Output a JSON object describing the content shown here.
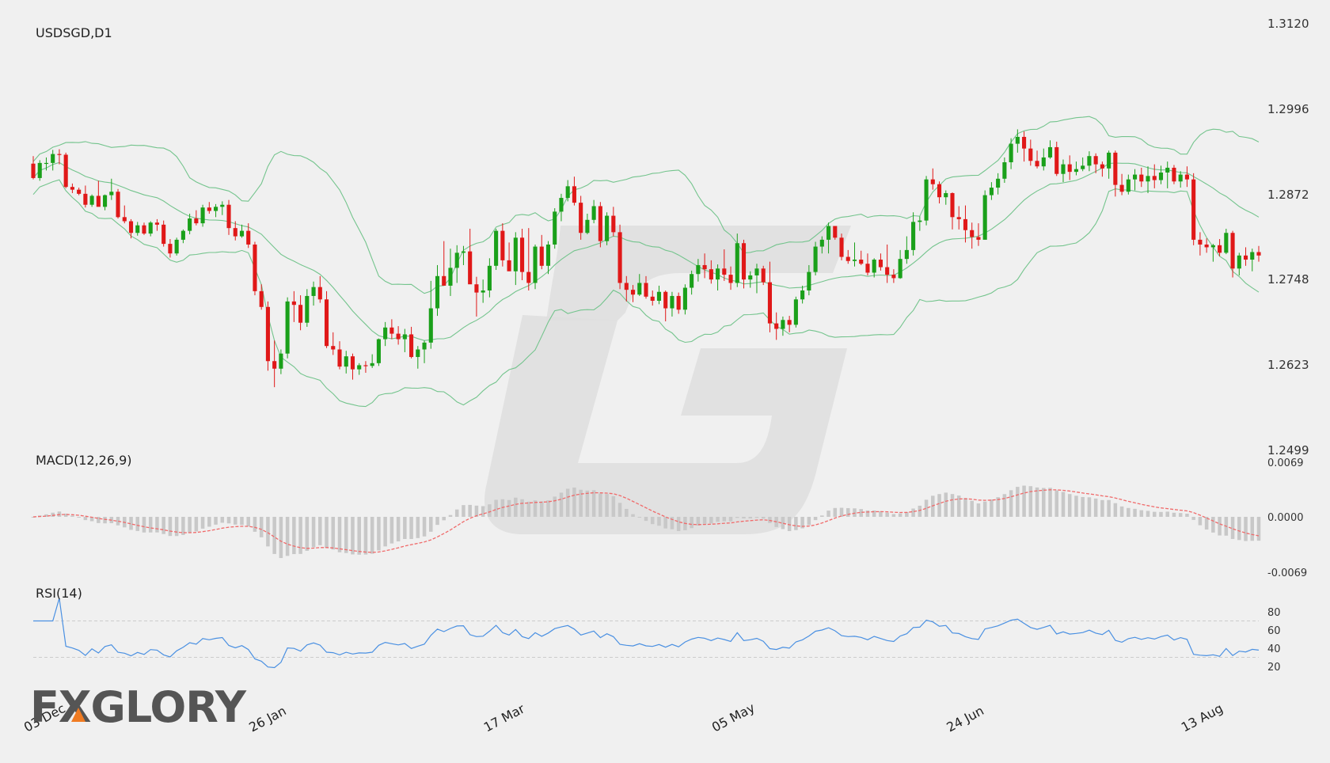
{
  "brand": {
    "logo_text": "FXGLORY",
    "accent": "#f07b22"
  },
  "colors": {
    "background": "#f0f0f0",
    "bull": "#1aa01a",
    "bear": "#e01818",
    "band": "#74c48d",
    "macd_line": "#f06a6a",
    "macd_hist": "#c8c8c8",
    "rsi_line": "#4a90e2",
    "grid_dash": "#cccccc",
    "watermark": "#dedede"
  },
  "chart_data": [
    {
      "type": "candlestick",
      "title": "USDSGD,D1",
      "symbol": "USDSGD",
      "timeframe": "D1",
      "ylim": [
        1.2499,
        1.312
      ],
      "y_ticks": [
        "1.3120",
        "1.2996",
        "1.2872",
        "1.2748",
        "1.2623",
        "1.2499"
      ],
      "x_tick_labels": [
        "03 Dec",
        "26 Jan",
        "17 Mar",
        "05 May",
        "24 Jun",
        "13 Aug"
      ],
      "x_tick_index": [
        0,
        36,
        72,
        107,
        143,
        179
      ],
      "bollinger": {
        "period": 20,
        "deviations": 2
      },
      "ohlc": [
        [
          1.2916,
          1.2927,
          1.2893,
          1.2895
        ],
        [
          1.2895,
          1.2921,
          1.2891,
          1.2917
        ],
        [
          1.2917,
          1.2925,
          1.2906,
          1.2917
        ],
        [
          1.2917,
          1.2936,
          1.2906,
          1.293
        ],
        [
          1.293,
          1.2937,
          1.2915,
          1.2929
        ],
        [
          1.2929,
          1.2932,
          1.288,
          1.2882
        ],
        [
          1.2882,
          1.2887,
          1.2873,
          1.2878
        ],
        [
          1.2878,
          1.2881,
          1.287,
          1.2872
        ],
        [
          1.2872,
          1.2884,
          1.2852,
          1.2856
        ],
        [
          1.2856,
          1.2871,
          1.2853,
          1.2869
        ],
        [
          1.2869,
          1.2891,
          1.2866,
          1.2853
        ],
        [
          1.2853,
          1.2871,
          1.2848,
          1.287
        ],
        [
          1.287,
          1.2894,
          1.2863,
          1.2875
        ],
        [
          1.2875,
          1.2879,
          1.2836,
          1.2838
        ],
        [
          1.2838,
          1.2855,
          1.2829,
          1.2832
        ],
        [
          1.2832,
          1.2835,
          1.2807,
          1.2815
        ],
        [
          1.2815,
          1.2831,
          1.2811,
          1.2826
        ],
        [
          1.2826,
          1.283,
          1.2812,
          1.2814
        ],
        [
          1.2814,
          1.2832,
          1.281,
          1.283
        ],
        [
          1.283,
          1.2835,
          1.2818,
          1.2827
        ],
        [
          1.2827,
          1.2833,
          1.2795,
          1.2799
        ],
        [
          1.2799,
          1.2806,
          1.2779,
          1.2785
        ],
        [
          1.2785,
          1.2808,
          1.2782,
          1.2805
        ],
        [
          1.2805,
          1.282,
          1.28,
          1.2818
        ],
        [
          1.2818,
          1.2843,
          1.2813,
          1.2836
        ],
        [
          1.2836,
          1.2848,
          1.2826,
          1.2829
        ],
        [
          1.2829,
          1.2856,
          1.2824,
          1.2852
        ],
        [
          1.2852,
          1.286,
          1.2843,
          1.2847
        ],
        [
          1.2847,
          1.2857,
          1.2838,
          1.2853
        ],
        [
          1.2853,
          1.2861,
          1.2841,
          1.2856
        ],
        [
          1.2856,
          1.2863,
          1.2812,
          1.2822
        ],
        [
          1.2822,
          1.2832,
          1.2804,
          1.281
        ],
        [
          1.281,
          1.2827,
          1.2808,
          1.2818
        ],
        [
          1.2818,
          1.2829,
          1.2793,
          1.2798
        ],
        [
          1.2798,
          1.2802,
          1.2724,
          1.273
        ],
        [
          1.273,
          1.274,
          1.2703,
          1.2707
        ],
        [
          1.2707,
          1.2715,
          1.2614,
          1.2628
        ],
        [
          1.2628,
          1.2658,
          1.259,
          1.2617
        ],
        [
          1.2617,
          1.2645,
          1.2609,
          1.2639
        ],
        [
          1.2639,
          1.2721,
          1.2632,
          1.2715
        ],
        [
          1.2715,
          1.273,
          1.2685,
          1.271
        ],
        [
          1.271,
          1.2724,
          1.2673,
          1.2684
        ],
        [
          1.2684,
          1.2733,
          1.2678,
          1.2723
        ],
        [
          1.2723,
          1.2744,
          1.2709,
          1.2736
        ],
        [
          1.2736,
          1.2752,
          1.2713,
          1.2718
        ],
        [
          1.2718,
          1.273,
          1.2647,
          1.265
        ],
        [
          1.265,
          1.267,
          1.2637,
          1.2645
        ],
        [
          1.2645,
          1.2657,
          1.2616,
          1.262
        ],
        [
          1.262,
          1.2643,
          1.261,
          1.2635
        ],
        [
          1.2635,
          1.2639,
          1.2601,
          1.2616
        ],
        [
          1.2616,
          1.2625,
          1.2608,
          1.2622
        ],
        [
          1.2622,
          1.2628,
          1.2611,
          1.2621
        ],
        [
          1.2621,
          1.2638,
          1.2618,
          1.2625
        ],
        [
          1.2625,
          1.2661,
          1.2621,
          1.266
        ],
        [
          1.266,
          1.2685,
          1.265,
          1.2677
        ],
        [
          1.2677,
          1.2689,
          1.266,
          1.2668
        ],
        [
          1.2668,
          1.2679,
          1.2652,
          1.266
        ],
        [
          1.266,
          1.2675,
          1.2641,
          1.2667
        ],
        [
          1.2667,
          1.2678,
          1.2632,
          1.2634
        ],
        [
          1.2634,
          1.265,
          1.2617,
          1.2645
        ],
        [
          1.2645,
          1.2658,
          1.2625,
          1.2655
        ],
        [
          1.2655,
          1.2745,
          1.2646,
          1.2705
        ],
        [
          1.2705,
          1.2768,
          1.2694,
          1.2752
        ],
        [
          1.2752,
          1.2803,
          1.2739,
          1.2738
        ],
        [
          1.2738,
          1.2792,
          1.2723,
          1.2764
        ],
        [
          1.2764,
          1.2797,
          1.2742,
          1.2786
        ],
        [
          1.2786,
          1.2796,
          1.2768,
          1.2788
        ],
        [
          1.2788,
          1.2821,
          1.2766,
          1.274
        ],
        [
          1.274,
          1.2751,
          1.2693,
          1.2728
        ],
        [
          1.2728,
          1.2747,
          1.2713,
          1.2731
        ],
        [
          1.2731,
          1.2778,
          1.2721,
          1.2767
        ],
        [
          1.2767,
          1.2821,
          1.2761,
          1.2818
        ],
        [
          1.2818,
          1.2829,
          1.2766,
          1.2775
        ],
        [
          1.2775,
          1.2801,
          1.2765,
          1.2759
        ],
        [
          1.2759,
          1.2816,
          1.2739,
          1.2808
        ],
        [
          1.2808,
          1.2821,
          1.2746,
          1.2758
        ],
        [
          1.2758,
          1.2822,
          1.2731,
          1.2742
        ],
        [
          1.2742,
          1.2798,
          1.2733,
          1.2795
        ],
        [
          1.2795,
          1.2812,
          1.2762,
          1.2767
        ],
        [
          1.2767,
          1.2803,
          1.2755,
          1.2798
        ],
        [
          1.2798,
          1.2851,
          1.2792,
          1.2846
        ],
        [
          1.2846,
          1.2872,
          1.2832,
          1.2866
        ],
        [
          1.2866,
          1.2892,
          1.2861,
          1.2883
        ],
        [
          1.2883,
          1.2897,
          1.2855,
          1.2859
        ],
        [
          1.2859,
          1.2869,
          1.2805,
          1.2815
        ],
        [
          1.2815,
          1.2843,
          1.2813,
          1.2834
        ],
        [
          1.2834,
          1.2863,
          1.2829,
          1.2854
        ],
        [
          1.2854,
          1.286,
          1.2794,
          1.2803
        ],
        [
          1.2803,
          1.2845,
          1.2797,
          1.284
        ],
        [
          1.284,
          1.2853,
          1.281,
          1.2816
        ],
        [
          1.2816,
          1.2827,
          1.2733,
          1.2742
        ],
        [
          1.2742,
          1.2752,
          1.2715,
          1.2732
        ],
        [
          1.2732,
          1.2739,
          1.2714,
          1.2725
        ],
        [
          1.2725,
          1.2755,
          1.2723,
          1.2742
        ],
        [
          1.2742,
          1.2752,
          1.2719,
          1.2722
        ],
        [
          1.2722,
          1.2731,
          1.2709,
          1.2716
        ],
        [
          1.2716,
          1.2738,
          1.2711,
          1.2729
        ],
        [
          1.2729,
          1.2731,
          1.2686,
          1.2705
        ],
        [
          1.2705,
          1.2729,
          1.2693,
          1.2723
        ],
        [
          1.2723,
          1.2728,
          1.2697,
          1.2703
        ],
        [
          1.2703,
          1.274,
          1.2696,
          1.2735
        ],
        [
          1.2735,
          1.276,
          1.2725,
          1.2755
        ],
        [
          1.2755,
          1.2777,
          1.2744,
          1.2768
        ],
        [
          1.2768,
          1.2785,
          1.2749,
          1.2762
        ],
        [
          1.2762,
          1.2775,
          1.2741,
          1.2747
        ],
        [
          1.2747,
          1.2769,
          1.2731,
          1.2763
        ],
        [
          1.2763,
          1.2791,
          1.2745,
          1.2754
        ],
        [
          1.2754,
          1.2766,
          1.2732,
          1.2742
        ],
        [
          1.2742,
          1.2814,
          1.2736,
          1.28
        ],
        [
          1.28,
          1.2805,
          1.2734,
          1.2747
        ],
        [
          1.2747,
          1.2759,
          1.2735,
          1.2753
        ],
        [
          1.2753,
          1.277,
          1.2727,
          1.2763
        ],
        [
          1.2763,
          1.2767,
          1.2739,
          1.2743
        ],
        [
          1.2743,
          1.2773,
          1.267,
          1.2683
        ],
        [
          1.2683,
          1.2699,
          1.2659,
          1.2675
        ],
        [
          1.2675,
          1.2693,
          1.2665,
          1.2688
        ],
        [
          1.2688,
          1.2694,
          1.267,
          1.2681
        ],
        [
          1.2681,
          1.2722,
          1.2677,
          1.2718
        ],
        [
          1.2718,
          1.2738,
          1.2712,
          1.2731
        ],
        [
          1.2731,
          1.2768,
          1.2724,
          1.2758
        ],
        [
          1.2758,
          1.2802,
          1.2753,
          1.2795
        ],
        [
          1.2795,
          1.281,
          1.2785,
          1.2805
        ],
        [
          1.2805,
          1.283,
          1.2785,
          1.2825
        ],
        [
          1.2825,
          1.2823,
          1.2805,
          1.2808
        ],
        [
          1.2808,
          1.2814,
          1.2775,
          1.278
        ],
        [
          1.278,
          1.279,
          1.277,
          1.2774
        ],
        [
          1.2774,
          1.2801,
          1.2766,
          1.2776
        ],
        [
          1.2776,
          1.2789,
          1.2768,
          1.277
        ],
        [
          1.277,
          1.2785,
          1.2753,
          1.2757
        ],
        [
          1.2757,
          1.2778,
          1.275,
          1.2776
        ],
        [
          1.2776,
          1.2785,
          1.276,
          1.2765
        ],
        [
          1.2765,
          1.2798,
          1.2742,
          1.2754
        ],
        [
          1.2754,
          1.2762,
          1.2742,
          1.2749
        ],
        [
          1.2749,
          1.279,
          1.2748,
          1.2777
        ],
        [
          1.2777,
          1.281,
          1.277,
          1.279
        ],
        [
          1.279,
          1.2845,
          1.2782,
          1.2831
        ],
        [
          1.2831,
          1.2839,
          1.2818,
          1.2833
        ],
        [
          1.2833,
          1.2898,
          1.2826,
          1.2893
        ],
        [
          1.2893,
          1.2909,
          1.2878,
          1.2886
        ],
        [
          1.2886,
          1.289,
          1.2858,
          1.2867
        ],
        [
          1.2867,
          1.2877,
          1.2856,
          1.2873
        ],
        [
          1.2873,
          1.2874,
          1.282,
          1.2838
        ],
        [
          1.2838,
          1.2854,
          1.282,
          1.2835
        ],
        [
          1.2835,
          1.2855,
          1.2801,
          1.2819
        ],
        [
          1.2819,
          1.283,
          1.2792,
          1.2809
        ],
        [
          1.2809,
          1.2829,
          1.2796,
          1.2805
        ],
        [
          1.2805,
          1.2877,
          1.2806,
          1.287
        ],
        [
          1.287,
          1.2889,
          1.2863,
          1.2881
        ],
        [
          1.2881,
          1.2902,
          1.2871,
          1.2894
        ],
        [
          1.2894,
          1.2925,
          1.2888,
          1.2918
        ],
        [
          1.2918,
          1.2953,
          1.2908,
          1.2945
        ],
        [
          1.2945,
          1.2966,
          1.2932,
          1.2955
        ],
        [
          1.2955,
          1.2963,
          1.2919,
          1.2938
        ],
        [
          1.2938,
          1.2951,
          1.2913,
          1.292
        ],
        [
          1.292,
          1.2935,
          1.2909,
          1.2912
        ],
        [
          1.2912,
          1.2938,
          1.2906,
          1.2925
        ],
        [
          1.2925,
          1.295,
          1.2923,
          1.294
        ],
        [
          1.294,
          1.2948,
          1.2898,
          1.2901
        ],
        [
          1.2901,
          1.2922,
          1.2889,
          1.2915
        ],
        [
          1.2915,
          1.2928,
          1.2892,
          1.2904
        ],
        [
          1.2904,
          1.2919,
          1.2899,
          1.2908
        ],
        [
          1.2908,
          1.2925,
          1.2905,
          1.2913
        ],
        [
          1.2913,
          1.2934,
          1.2905,
          1.2927
        ],
        [
          1.2927,
          1.2931,
          1.2902,
          1.2915
        ],
        [
          1.2915,
          1.2919,
          1.2897,
          1.2909
        ],
        [
          1.2909,
          1.2935,
          1.2894,
          1.2932
        ],
        [
          1.2932,
          1.2935,
          1.2868,
          1.2885
        ],
        [
          1.2885,
          1.2901,
          1.287,
          1.2875
        ],
        [
          1.2875,
          1.29,
          1.2871,
          1.2893
        ],
        [
          1.2893,
          1.2908,
          1.2877,
          1.29
        ],
        [
          1.29,
          1.291,
          1.2882,
          1.289
        ],
        [
          1.289,
          1.2912,
          1.2873,
          1.2898
        ],
        [
          1.2898,
          1.2915,
          1.288,
          1.2892
        ],
        [
          1.2892,
          1.2913,
          1.2886,
          1.2903
        ],
        [
          1.2903,
          1.2919,
          1.288,
          1.291
        ],
        [
          1.291,
          1.2914,
          1.2886,
          1.289
        ],
        [
          1.289,
          1.2905,
          1.2881,
          1.29
        ],
        [
          1.29,
          1.2912,
          1.2882,
          1.2893
        ],
        [
          1.2893,
          1.2902,
          1.2797,
          1.2805
        ],
        [
          1.2805,
          1.2816,
          1.2782,
          1.2798
        ],
        [
          1.2798,
          1.2807,
          1.2786,
          1.2794
        ],
        [
          1.2794,
          1.2799,
          1.2773,
          1.2797
        ],
        [
          1.2797,
          1.2806,
          1.2781,
          1.2786
        ],
        [
          1.2786,
          1.2821,
          1.2784,
          1.2815
        ],
        [
          1.2815,
          1.2818,
          1.275,
          1.2763
        ],
        [
          1.2763,
          1.2786,
          1.2753,
          1.2782
        ],
        [
          1.2782,
          1.2794,
          1.2767,
          1.2776
        ],
        [
          1.2776,
          1.2792,
          1.2759,
          1.2787
        ],
        [
          1.2787,
          1.2796,
          1.2773,
          1.2782
        ]
      ]
    },
    {
      "type": "line",
      "title": "MACD(12,26,9)",
      "ylim": [
        -0.0069,
        0.0069
      ],
      "y_ticks": [
        "0.0069",
        "0.0000",
        "-0.0069"
      ],
      "histogram_series": "MACD",
      "line_series": "Signal"
    },
    {
      "type": "line",
      "title": "RSI(14)",
      "ylim": [
        10,
        90
      ],
      "y_ticks": [
        "80",
        "60",
        "40",
        "20"
      ],
      "levels": [
        70,
        30
      ],
      "period": 14
    }
  ]
}
